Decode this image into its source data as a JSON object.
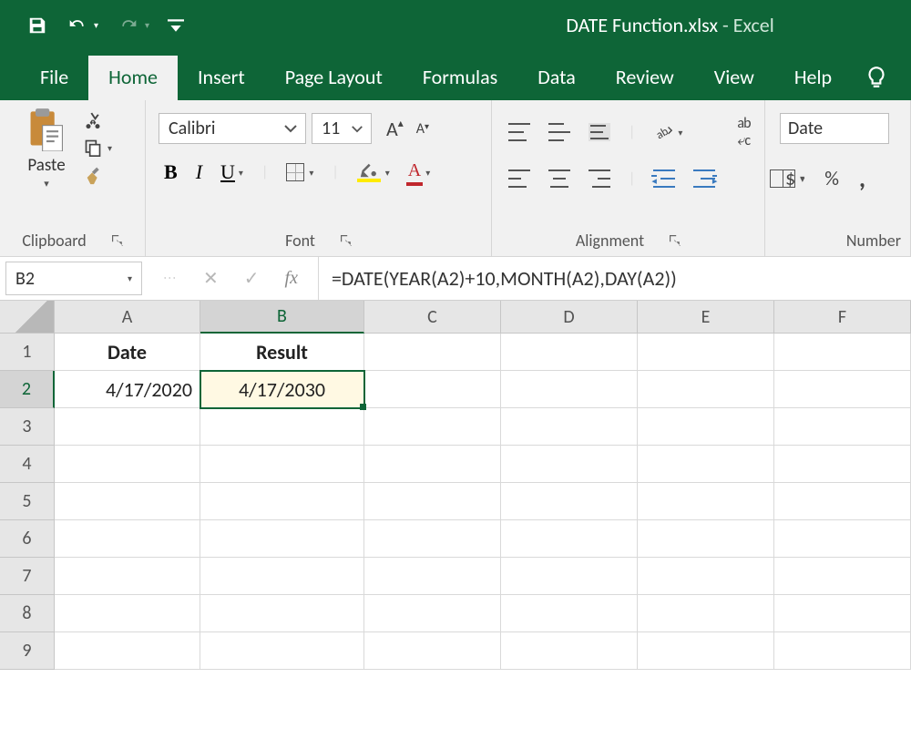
{
  "titlebar": {
    "filename": "DATE Function.xlsx",
    "sep": "  -  ",
    "app": "Excel"
  },
  "tabs": [
    "File",
    "Home",
    "Insert",
    "Page Layout",
    "Formulas",
    "Data",
    "Review",
    "View",
    "Help"
  ],
  "active_tab": "Home",
  "ribbon": {
    "clipboard": {
      "label": "Clipboard",
      "paste": "Paste"
    },
    "font": {
      "label": "Font",
      "name": "Calibri",
      "size": "11"
    },
    "alignment": {
      "label": "Alignment"
    },
    "number": {
      "label": "Number",
      "format": "Date",
      "currency": "$",
      "percent": "%",
      "comma": ","
    }
  },
  "fx": {
    "namebox": "B2",
    "formula": "=DATE(YEAR(A2)+10,MONTH(A2),DAY(A2))",
    "fx_label": "fx"
  },
  "sheet": {
    "cols": [
      "A",
      "B",
      "C",
      "D",
      "E",
      "F"
    ],
    "rows": [
      "1",
      "2",
      "3",
      "4",
      "5",
      "6",
      "7",
      "8",
      "9"
    ],
    "selected_col": "B",
    "selected_row": "2",
    "cells": {
      "A1": "Date",
      "B1": "Result",
      "A2": "4/17/2020",
      "B2": "4/17/2030"
    }
  }
}
